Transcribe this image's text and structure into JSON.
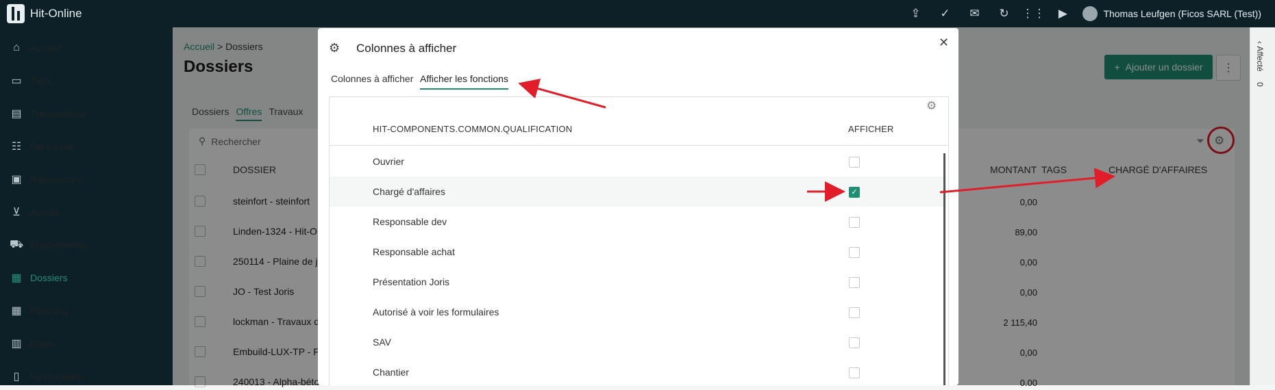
{
  "app": {
    "name": "Hit-Online"
  },
  "topbar": {
    "icons": [
      "upload-icon",
      "check-plus-icon",
      "mail-icon",
      "refresh-icon",
      "apps-grid-icon",
      "video-icon"
    ],
    "user": "Thomas Leufgen (Ficos SARL (Test))"
  },
  "sidebar": {
    "items": [
      {
        "label": "Accueil",
        "icon": "home-icon"
      },
      {
        "label": "Tiers",
        "icon": "card-icon"
      },
      {
        "label": "Transactions",
        "icon": "receipt-icon"
      },
      {
        "label": "Personnel",
        "icon": "people-icon"
      },
      {
        "label": "Ressources",
        "icon": "box-icon"
      },
      {
        "label": "Achats",
        "icon": "cart-icon"
      },
      {
        "label": "Équipements",
        "icon": "truck-icon"
      },
      {
        "label": "Dossiers",
        "icon": "folder-icon",
        "active": true
      },
      {
        "label": "Planning",
        "icon": "calendar-icon"
      },
      {
        "label": "Coûts",
        "icon": "chart-icon"
      },
      {
        "label": "Formulaires",
        "icon": "clipboard-icon"
      }
    ]
  },
  "page": {
    "breadcrumb_link": "Accueil",
    "breadcrumb_sep": ">",
    "breadcrumb_current": "Dossiers",
    "title": "Dossiers",
    "add_button": "Ajouter un dossier",
    "more_button": "⋮",
    "tabs": [
      "Dossiers",
      "Offres",
      "Travaux"
    ],
    "search_placeholder": "Rechercher",
    "columns": {
      "dossier": "DOSSIER",
      "montant": "MONTANT",
      "tags": "TAGS",
      "charge": "CHARGÉ D'AFFAIRES"
    },
    "rows": [
      {
        "name": "steinfort - steinfort",
        "amount": "0,00"
      },
      {
        "name": "Linden-1324 - Hit-O",
        "amount": "89,00"
      },
      {
        "name": "250114 - Plaine de j",
        "amount": "0,00"
      },
      {
        "name": "JO - Test Joris",
        "amount": "0,00"
      },
      {
        "name": "lockman - Travaux d",
        "amount": "2 115,40"
      },
      {
        "name": "Embuild-LUX-TP - F",
        "amount": "0,00"
      },
      {
        "name": "240013 - Alpha-béto",
        "amount": "0.00"
      }
    ],
    "right_panel": {
      "label": "Affecté",
      "count": "0"
    }
  },
  "modal": {
    "title": "Colonnes à afficher",
    "tabs": [
      "Colonnes à afficher",
      "Afficher les fonctions"
    ],
    "active_tab": "Afficher les fonctions",
    "col_qualification": "HIT-COMPONENTS.COMMON.QUALIFICATION",
    "col_afficher": "AFFICHER",
    "rows": [
      {
        "label": "Ouvrier",
        "checked": false
      },
      {
        "label": "Chargé d'affaires",
        "checked": true
      },
      {
        "label": "Responsable dev",
        "checked": false
      },
      {
        "label": "Responsable achat",
        "checked": false
      },
      {
        "label": "Présentation Joris",
        "checked": false
      },
      {
        "label": "Autorisé à voir les formulaires",
        "checked": false
      },
      {
        "label": "SAV",
        "checked": false
      },
      {
        "label": "Chantier",
        "checked": false
      }
    ]
  },
  "colors": {
    "accent": "#1f8f73",
    "sidebar": "#0d2028",
    "annotation": "#e11d2a"
  }
}
